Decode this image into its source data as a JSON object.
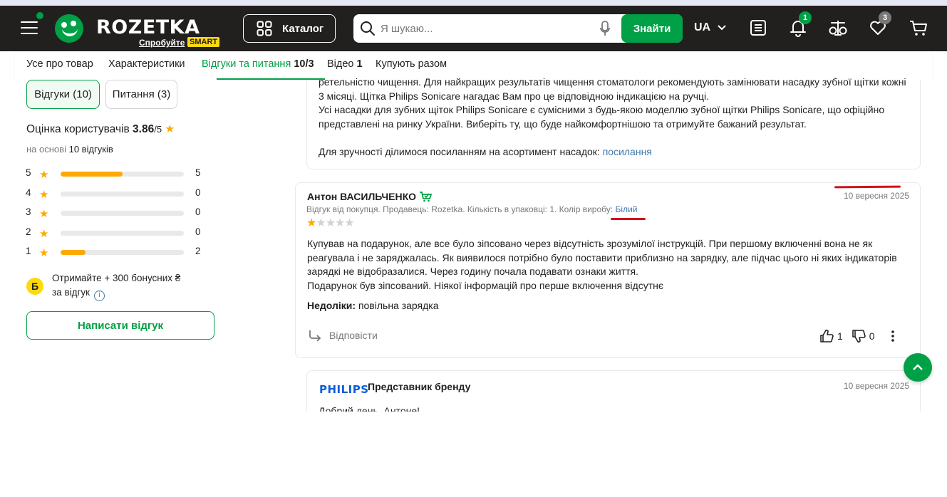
{
  "header": {
    "logo_text": "ROZETKA",
    "logo_sub": "Спробуйте",
    "logo_smart": "SMART",
    "catalog_label": "Каталог",
    "search_placeholder": "Я шукаю...",
    "search_button": "Знайти",
    "lang": "UA",
    "notifications_badge": "1",
    "wishlist_badge": "3",
    "brand_color": "#00a046"
  },
  "tabs": [
    {
      "label": "Усе про товар",
      "count": ""
    },
    {
      "label": "Характеристики",
      "count": ""
    },
    {
      "label": "Відгуки та питання",
      "count": "10/3"
    },
    {
      "label": "Відео",
      "count": "1"
    },
    {
      "label": "Купують разом",
      "count": ""
    }
  ],
  "sidebar": {
    "filter_reviews": "Відгуки (10)",
    "filter_questions": "Питання (3)",
    "rating_label": "Оцінка користувачів",
    "rating_value": "3.86",
    "rating_max": "/5",
    "based_on_prefix": "на основі",
    "based_on_count": "10 відгуків",
    "distribution": [
      {
        "stars": "5",
        "count": "5",
        "fraction": 0.5
      },
      {
        "stars": "4",
        "count": "0",
        "fraction": 0
      },
      {
        "stars": "3",
        "count": "0",
        "fraction": 0
      },
      {
        "stars": "2",
        "count": "0",
        "fraction": 0
      },
      {
        "stars": "1",
        "count": "2",
        "fraction": 0.2
      }
    ],
    "bonus_badge": "Б",
    "bonus_text_1": "Отримайте + 300 бонусних ₴",
    "bonus_text_2": "за відгук",
    "write_review": "Написати відгук"
  },
  "prev_reply": {
    "line1": "ретельністю чищення. Для найкращих результатів чищення стоматологи рекомендують замінювати насадку зубної щітки кожні",
    "line2": "3 місяці. Щітка Philips Sonicare нагадає Вам про це відповідною індикацією на ручці.",
    "line3": "Усі насадки для зубних щіток Philips Sonicare є сумісними з будь-якою моделлю зубної щітки Philips Sonicare, що офіційно",
    "line4": "представлені на ринку України. Виберіть ту, що буде найкомфортнішою та отримуйте бажаний результат.",
    "line5_prefix": "Для зручності ділимося посиланням на асортимент насадок:",
    "link": "посилання"
  },
  "review": {
    "author": "Антон ВАСИЛЬЧЕНКО",
    "date": "10 вересня 2025",
    "meta_prefix": "Відгук від покупця. Продавець: Rozetka. Кількість в упаковці: 1. Колір виробу:",
    "meta_color": "Білий",
    "rating": 1,
    "text_1": "Купував на подарунок, але все було зіпсовано через відсутність зрозумілої інструкцій. При першому включенні вона не як",
    "text_2": "реагувала і не заряджалась. Як виявилося потрібно було поставити приблизно на зарядку, але підчас цього ні яких індикаторів",
    "text_3": "зарядкі не відобразалися. Через годину почала подавати ознаки життя.",
    "text_4": "Подарунок був зіпсований. Ніякої інформацій про перше включення відсутнє",
    "cons_label": "Недоліки:",
    "cons_text": "повільна зарядка",
    "reply_label": "Відповісти",
    "likes": "1",
    "dislikes": "0"
  },
  "brand_reply": {
    "brand": "PHILIPS",
    "role": "Представник бренду",
    "date": "10 вересня 2025",
    "text": "Добрий день, Антоне!"
  },
  "annotation_color": "#d1111a"
}
